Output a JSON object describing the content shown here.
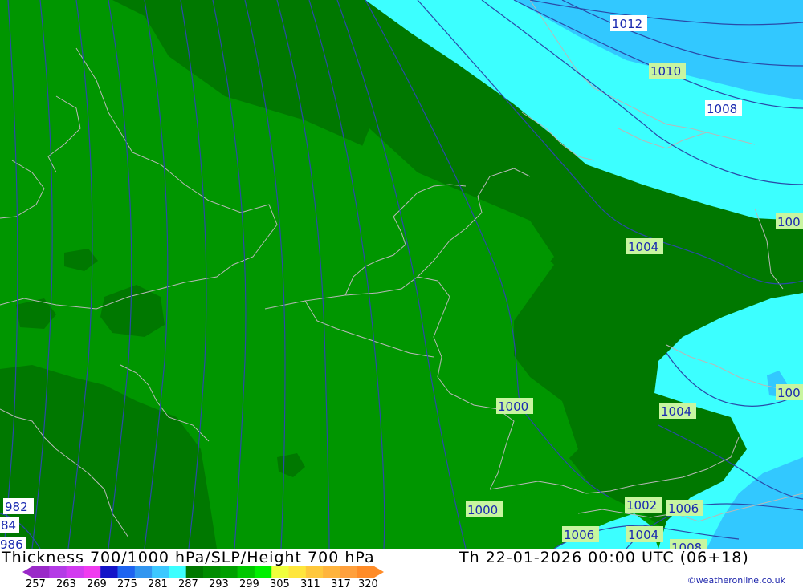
{
  "header": {
    "title": "Thickness 700/1000 hPa/SLP/Height 700 hPa",
    "valid_time": "Th 22-01-2026 00:00 UTC (06+18)"
  },
  "credit": "©weatheronline.co.uk",
  "colors": {
    "land_outline": "#b8b8b8",
    "isobar_line": "#2a4aa8",
    "label_bg_green": "#c8f5a0",
    "label_bg_white": "#ffffff",
    "label_text": "#1a2ab0"
  },
  "bands": [
    {
      "name": "band-287-dark",
      "color": "#007800"
    },
    {
      "name": "band-290-mid",
      "color": "#009600"
    },
    {
      "name": "band-cyan",
      "color": "#3cffff"
    },
    {
      "name": "band-light-blue",
      "color": "#32c8ff"
    }
  ],
  "isobar_labels": [
    {
      "name": "isobar-label-1012",
      "text": "1012",
      "bg": "white"
    },
    {
      "name": "isobar-label-1010",
      "text": "1010",
      "bg": "green"
    },
    {
      "name": "isobar-label-1008-north",
      "text": "1008",
      "bg": "white"
    },
    {
      "name": "isobar-label-100-east",
      "text": "100",
      "bg": "green"
    },
    {
      "name": "isobar-label-1004-center",
      "text": "1004",
      "bg": "green"
    },
    {
      "name": "isobar-label-100-southeast",
      "text": "100",
      "bg": "green"
    },
    {
      "name": "isobar-label-1000-center",
      "text": "1000",
      "bg": "green"
    },
    {
      "name": "isobar-label-1004-south",
      "text": "1004",
      "bg": "green"
    },
    {
      "name": "isobar-label-982",
      "text": "982",
      "bg": "white"
    },
    {
      "name": "isobar-label-84",
      "text": "84",
      "bg": "white"
    },
    {
      "name": "isobar-label-986",
      "text": "986",
      "bg": "white"
    },
    {
      "name": "isobar-label-1000-south",
      "text": "1000",
      "bg": "green"
    },
    {
      "name": "isobar-label-1002",
      "text": "1002",
      "bg": "green"
    },
    {
      "name": "isobar-label-1006-east",
      "text": "1006",
      "bg": "green"
    },
    {
      "name": "isobar-label-1006-south",
      "text": "1006",
      "bg": "green"
    },
    {
      "name": "isobar-label-1004-bottom",
      "text": "1004",
      "bg": "green"
    },
    {
      "name": "isobar-label-1008-bottom",
      "text": "1008",
      "bg": "green"
    }
  ],
  "legend": {
    "ticks": [
      "257",
      "263",
      "269",
      "275",
      "281",
      "287",
      "293",
      "299",
      "305",
      "311",
      "317",
      "320"
    ],
    "colors": [
      "#9a2ac8",
      "#b43ce6",
      "#d23cf0",
      "#f03cf0",
      "#1414c8",
      "#1e64f0",
      "#3296f0",
      "#3cc8ff",
      "#3cffff",
      "#007800",
      "#008c00",
      "#00a000",
      "#00c800",
      "#00f000",
      "#f0ff3c",
      "#ffe63c",
      "#ffc83c",
      "#ffb43c",
      "#ffa03c",
      "#ff8c28"
    ]
  }
}
